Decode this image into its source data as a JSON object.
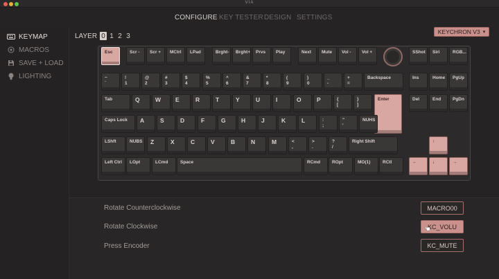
{
  "window": {
    "title": "VIA"
  },
  "nav": {
    "tabs": [
      "CONFIGURE",
      "KEY TESTER",
      "DESIGN",
      "SETTINGS"
    ],
    "active": "CONFIGURE"
  },
  "sidebar": {
    "items": [
      {
        "label": "KEYMAP",
        "icon": "keyboard-icon",
        "active": true
      },
      {
        "label": "MACROS",
        "icon": "circle-dot-icon",
        "active": false
      },
      {
        "label": "SAVE + LOAD",
        "icon": "floppy-disk-icon",
        "active": false
      },
      {
        "label": "LIGHTING",
        "icon": "lightbulb-icon",
        "active": false
      }
    ]
  },
  "layers": {
    "label": "LAYER",
    "numbers": [
      "0",
      "1",
      "2",
      "3"
    ],
    "active": "0"
  },
  "keyboard_select": {
    "value": "KEYCHRON V3",
    "icon": "chevron-down-icon"
  },
  "colors": {
    "accent": "#d9a7a2",
    "key": "#3a3737",
    "background": "#252323"
  },
  "keyboard": {
    "rows": [
      [
        "Esc",
        "Scr -",
        "Scr +",
        "MCtrl",
        "LPad",
        "Brght-",
        "Brght+",
        "Prvs",
        "Play",
        "Next",
        "Mute",
        "Vol -",
        "Vol +",
        "SShot",
        "Siri",
        "RGB..."
      ],
      [
        "~\n`",
        "!\n1",
        "@\n2",
        "#\n3",
        "$\n4",
        "%\n5",
        "^\n6",
        "&\n7",
        "*\n8",
        "(\n9",
        ")\n0",
        "_\n-",
        "+\n=",
        "Backspace",
        "Ins",
        "Home",
        "PgUp"
      ],
      [
        "Tab",
        "Q",
        "W",
        "E",
        "R",
        "T",
        "Y",
        "U",
        "I",
        "O",
        "P",
        "{\n[",
        "}\n]",
        "Enter",
        "Del",
        "End",
        "PgDn"
      ],
      [
        "Caps Lock",
        "A",
        "S",
        "D",
        "F",
        "G",
        "H",
        "J",
        "K",
        "L",
        ":\n;",
        "\"\n'",
        "NUHS"
      ],
      [
        "LShft",
        "NUBS",
        "Z",
        "X",
        "C",
        "V",
        "B",
        "N",
        "M",
        "<\n,",
        ">\n.",
        "?\n/",
        "Right Shift",
        "↑"
      ],
      [
        "Left Ctrl",
        "LOpt",
        "LCmd",
        "Space",
        "RCmd",
        "ROpt",
        "MO(1)",
        "RCtl",
        "←",
        "↓",
        "→"
      ]
    ],
    "encoder": "rotary-knob"
  },
  "encoder": {
    "rows": [
      {
        "label": "Rotate Counterclockwise",
        "value": "MACRO00"
      },
      {
        "label": "Rotate Clockwise",
        "value": "KC_VOLU"
      },
      {
        "label": "Press Encoder",
        "value": "KC_MUTE"
      }
    ]
  }
}
